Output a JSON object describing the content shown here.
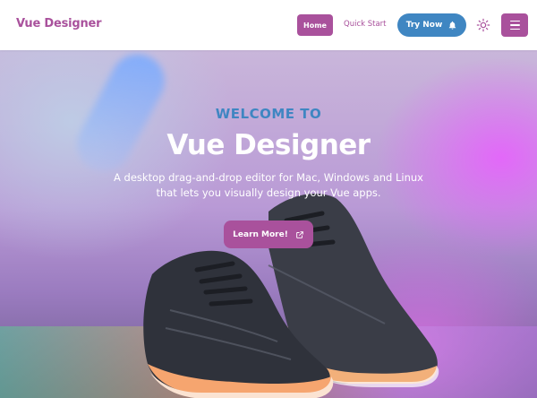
{
  "navbar": {
    "brand": "Vue Designer",
    "home_label": "Home",
    "quick_start_label": "Quick Start",
    "try_now_label": "Try Now"
  },
  "hero": {
    "welcome": "WELCOME TO",
    "title": "Vue Designer",
    "subtitle_line1": "A desktop drag-and-drop editor for Mac, Windows and Linux",
    "subtitle_line2": "that lets you visually design your Vue apps.",
    "cta_label": "Learn More!"
  },
  "colors": {
    "brand": "#a9519c",
    "accent_blue": "#3f86c2"
  },
  "icons": {
    "try_now": "bell-icon",
    "theme": "sun-icon",
    "menu": "hamburger-menu-icon",
    "cta": "external-link-icon"
  }
}
